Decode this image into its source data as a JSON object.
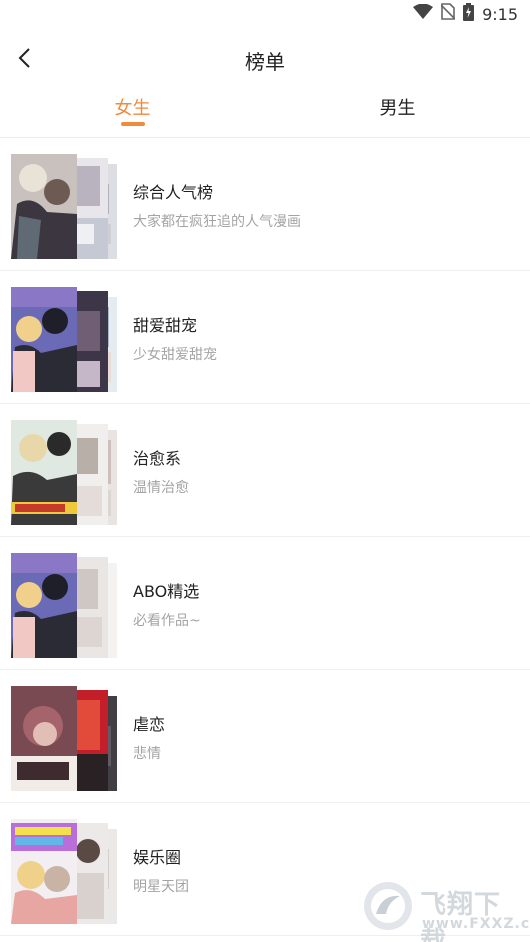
{
  "status_bar": {
    "time": "9:15",
    "icons": [
      "wifi-icon",
      "no-sim-icon",
      "battery-charging-icon"
    ]
  },
  "nav": {
    "title": "榜单",
    "back_icon": "chevron-left-icon"
  },
  "tabs": [
    {
      "label": "女生",
      "active": true
    },
    {
      "label": "男生",
      "active": false
    }
  ],
  "colors": {
    "accent": "#f08a3c",
    "title": "#222222",
    "subtitle": "#a4a4a4",
    "divider": "#efefef"
  },
  "rankings": [
    {
      "title": "综合人气榜",
      "subtitle": "大家都在疯狂追的人气漫画"
    },
    {
      "title": "甜爱甜宠",
      "subtitle": "少女甜爱甜宠"
    },
    {
      "title": "治愈系",
      "subtitle": "温情治愈"
    },
    {
      "title": "ABO精选",
      "subtitle": "必看作品~"
    },
    {
      "title": "虐恋",
      "subtitle": "悲情"
    },
    {
      "title": "娱乐圈",
      "subtitle": "明星天团"
    }
  ],
  "watermark": {
    "text": "飞翔下载",
    "domain": "www.FXXZ.com"
  }
}
